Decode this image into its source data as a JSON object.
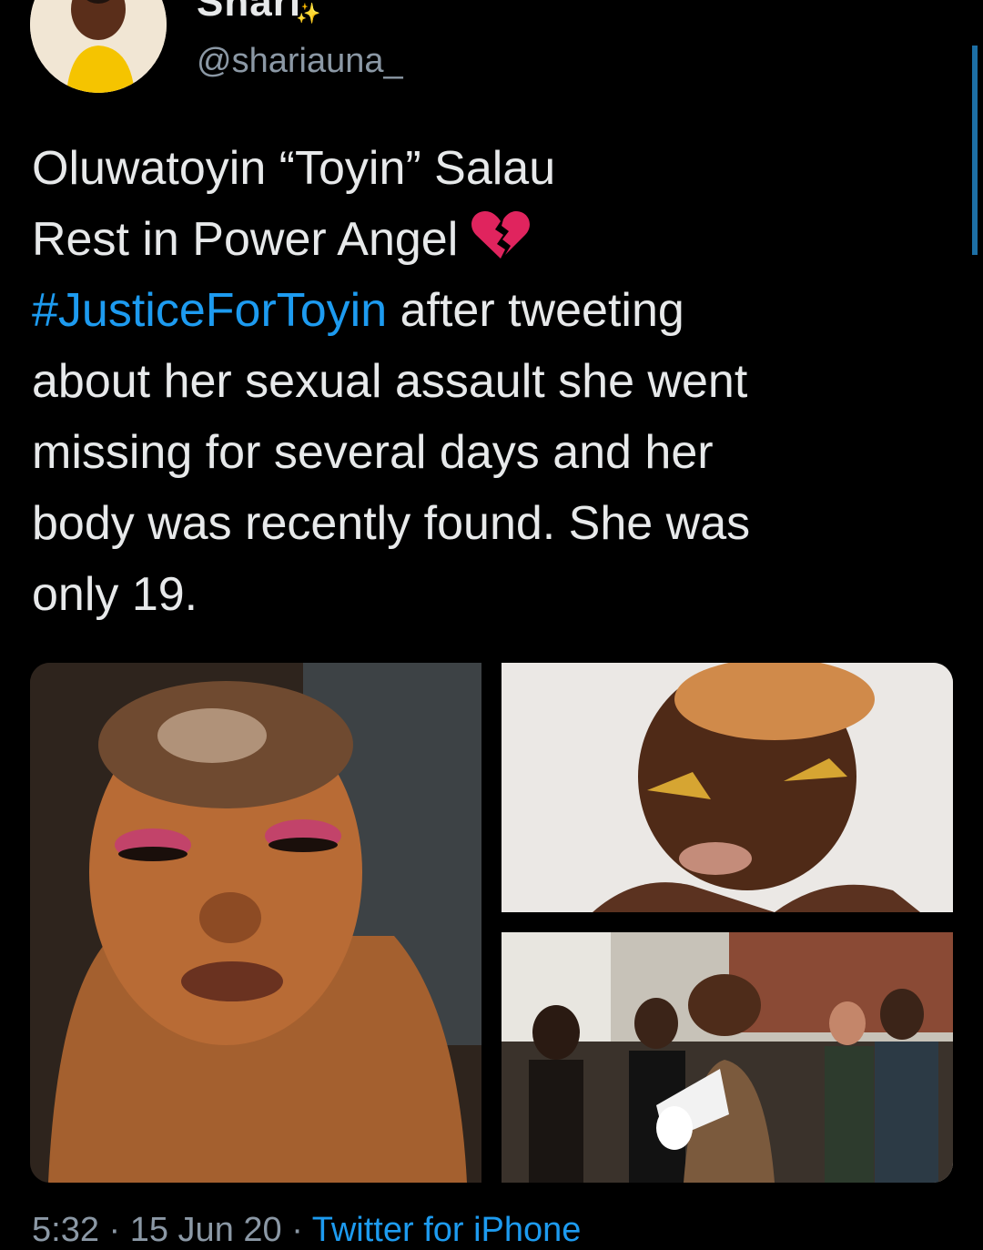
{
  "author": {
    "display_name": "Shari",
    "handle": "@shariauna_",
    "avatar_icon": "profile-photo",
    "sparkle_icon": "sparkles-emoji"
  },
  "tweet": {
    "line1": "Oluwatoyin “Toyin” Salau",
    "line2": "Rest in Power Angel",
    "hashtag": "#JusticeForToyin",
    "line3_rest": " after tweeting",
    "line4": "about her sexual assault she went",
    "line5": "missing for several days and her",
    "line6": "body was recently found. She was",
    "line7": "only 19.",
    "emoji": "broken-heart-emoji"
  },
  "media": [
    {
      "alt": "selfie-photo"
    },
    {
      "alt": "portrait-photo"
    },
    {
      "alt": "protest-photo"
    }
  ],
  "footer": {
    "time": "5:32 · 15 Jun 20 · ",
    "source": "Twitter for iPhone"
  },
  "colors": {
    "background": "#000000",
    "text": "#e7e9ea",
    "link": "#1d9bf0",
    "muted": "#8b98a5"
  }
}
